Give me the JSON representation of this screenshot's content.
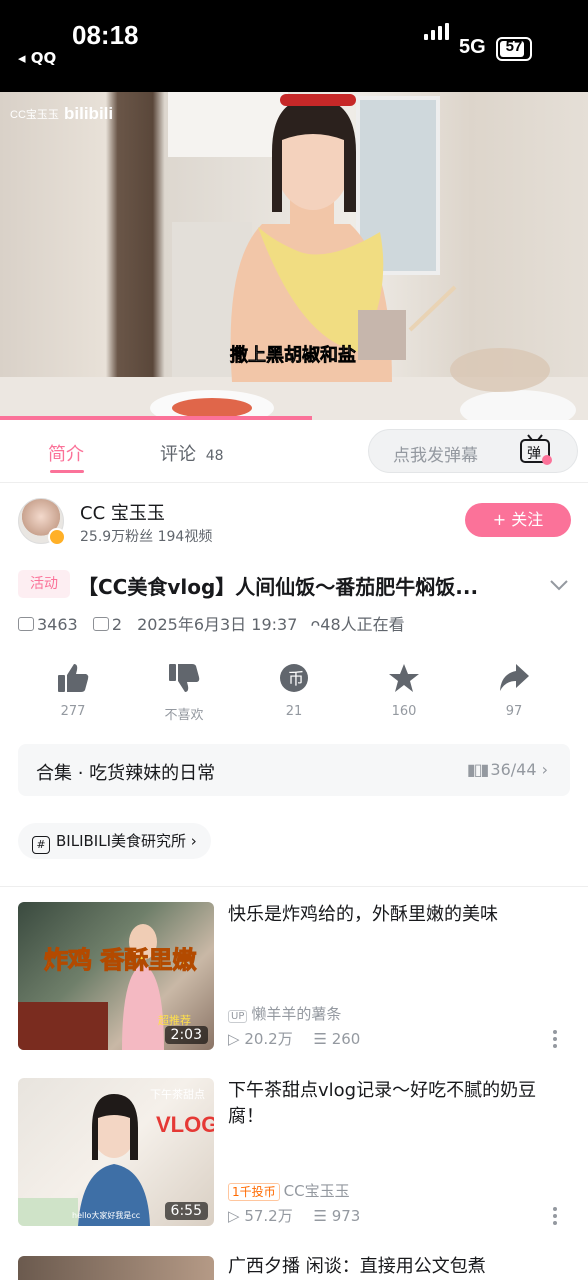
{
  "status_bar": {
    "time": "08:18",
    "back_app": "◂ QQ",
    "network": "5G",
    "battery": "57"
  },
  "video": {
    "watermark_owner": "CC宝玉玉",
    "watermark_brand": "bilibili",
    "subtitle": "撒上黑胡椒和盐",
    "progress": 0.53
  },
  "tabs": {
    "intro": "简介",
    "comments": "评论",
    "comments_count": "48",
    "danmaku_placeholder": "点我发弹幕",
    "danmaku_btn": "弹"
  },
  "uploader": {
    "name": "CC 宝玉玉",
    "stats": "25.9万粉丝  194视频",
    "follow_label": "+ 关注"
  },
  "video_info": {
    "tag": "活动",
    "title": "【CC美食vlog】人间仙饭～番茄肥牛焖饭...",
    "plays": "3463",
    "danmaku_count": "2",
    "date": "2025年6月3日 19:37",
    "watching": "48人正在看"
  },
  "actions": [
    {
      "name": "like",
      "count": "277"
    },
    {
      "name": "dislike",
      "count": "不喜欢"
    },
    {
      "name": "coin",
      "count": "21"
    },
    {
      "name": "favorite",
      "count": "160"
    },
    {
      "name": "share",
      "count": "97"
    }
  ],
  "collection": {
    "title": "合集 · 吃货辣妹的日常",
    "progress": "36/44"
  },
  "channel_chip": {
    "label": "BILIBILI美食研究所"
  },
  "related": [
    {
      "title": "快乐是炸鸡给的，外酥里嫩的美味",
      "up_badge": "UP",
      "up": "懒羊羊的薯条",
      "views": "20.2万",
      "danmaku": "260",
      "duration": "2:03",
      "thumb_text": "炸鸡 香酥里嫩",
      "thumb_badge": "超推荐"
    },
    {
      "title": "下午茶甜点vlog记录～好吃不腻的奶豆腐！",
      "coin_tag": "1千投币",
      "up": "CC宝玉玉",
      "views": "57.2万",
      "danmaku": "973",
      "duration": "6:55",
      "thumb_text": "VLOG",
      "thumb_badge": "下午茶甜点",
      "thumb_caption": "hello大家好我是cc"
    },
    {
      "title": "广西夕播 闲谈：直接用公文包煮"
    }
  ],
  "colors": {
    "accent": "#fb7299",
    "text": "#18191c",
    "secondary": "#61666d",
    "muted": "#9499a0"
  }
}
